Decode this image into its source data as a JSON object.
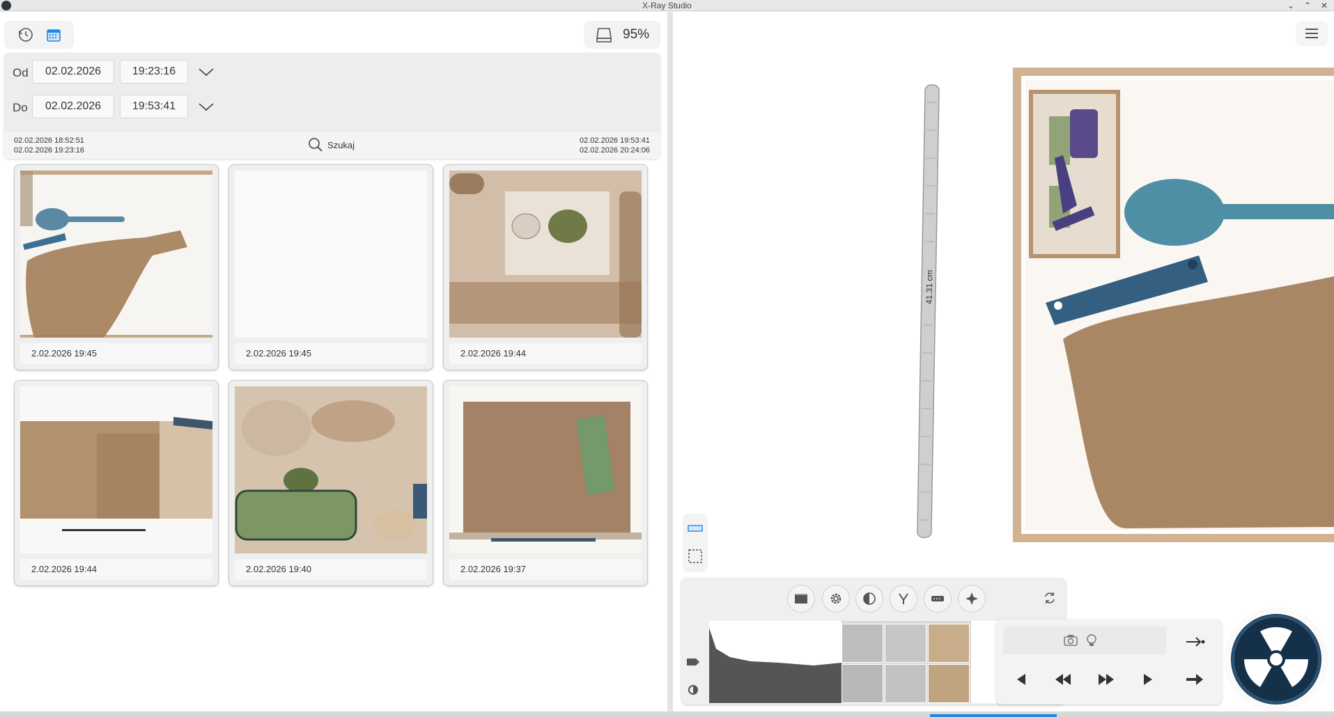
{
  "window": {
    "title": "X-Ray Studio"
  },
  "toolbar": {
    "storage_percent": "95%"
  },
  "filter": {
    "from_label": "Od",
    "from_date": "02.02.2026",
    "from_time": "19:23:16",
    "to_label": "Do",
    "to_date": "02.02.2026",
    "to_time": "19:53:41",
    "range_left_1": "02.02.2026 18:52:51",
    "range_left_2": "02.02.2026 19:23:16",
    "search_label": "Szukaj",
    "range_right_1": "02.02.2026 19:53:41",
    "range_right_2": "02.02.2026 20:24:06"
  },
  "gallery": [
    {
      "caption": "2.02.2026 19:45"
    },
    {
      "caption": "2.02.2026 19:45"
    },
    {
      "caption": "2.02.2026 19:44"
    },
    {
      "caption": "2.02.2026 19:44"
    },
    {
      "caption": "2.02.2026 19:40"
    },
    {
      "caption": "2.02.2026 19:37"
    }
  ],
  "viewer": {
    "ruler_measure": "41.31 cm"
  },
  "colors": {
    "accent": "#1e88e5",
    "xray_orange": "#a07850",
    "xray_blue": "#3c6e8c",
    "radiation_bg": "#15314a"
  },
  "icons": [
    "history-icon",
    "calendar-icon",
    "storage-icon",
    "grid-icon",
    "menu-icon",
    "search-icon",
    "chevron-down-icon",
    "measure-icon",
    "select-icon",
    "filter-icon",
    "settings-icon",
    "contrast-icon",
    "gamma-icon",
    "edge-icon",
    "enhance-icon",
    "rotate-icon",
    "tag-icon",
    "brightness-icon",
    "camera-icon",
    "bulb-icon",
    "prev-icon",
    "rewind-icon",
    "forward-icon",
    "play-icon",
    "next-icon",
    "dock-icon",
    "radiation-icon"
  ]
}
